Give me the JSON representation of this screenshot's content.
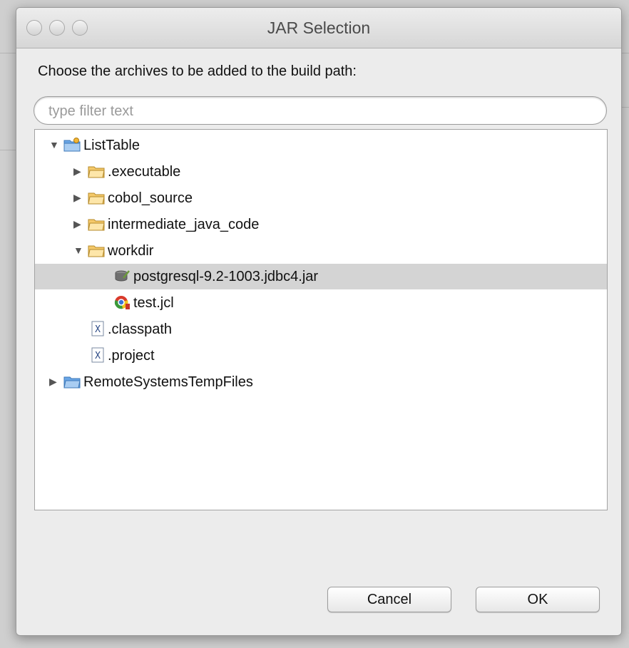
{
  "dialog": {
    "title": "JAR Selection",
    "prompt": "Choose the archives to be added to the build path:",
    "filter": {
      "placeholder": "type filter text",
      "value": ""
    }
  },
  "tree": {
    "items": [
      {
        "label": "ListTable",
        "type": "project",
        "expanded": true,
        "depth": 0
      },
      {
        "label": ".executable",
        "type": "folder",
        "expanded": false,
        "depth": 1
      },
      {
        "label": "cobol_source",
        "type": "folder",
        "expanded": false,
        "depth": 1
      },
      {
        "label": "intermediate_java_code",
        "type": "folder",
        "expanded": false,
        "depth": 1
      },
      {
        "label": "workdir",
        "type": "folder",
        "expanded": true,
        "depth": 1
      },
      {
        "label": "postgresql-9.2-1003.jdbc4.jar",
        "type": "jar",
        "selected": true,
        "depth": 2
      },
      {
        "label": "test.jcl",
        "type": "jcl",
        "depth": 2
      },
      {
        "label": ".classpath",
        "type": "xml",
        "depth": 1
      },
      {
        "label": ".project",
        "type": "xml",
        "depth": 1
      },
      {
        "label": "RemoteSystemsTempFiles",
        "type": "project",
        "expanded": false,
        "depth": 0
      }
    ]
  },
  "buttons": {
    "cancel": "Cancel",
    "ok": "OK"
  },
  "colors": {
    "selection": "#d4d4d4",
    "folder": "#f5c96a",
    "project": "#6aa6e6"
  }
}
